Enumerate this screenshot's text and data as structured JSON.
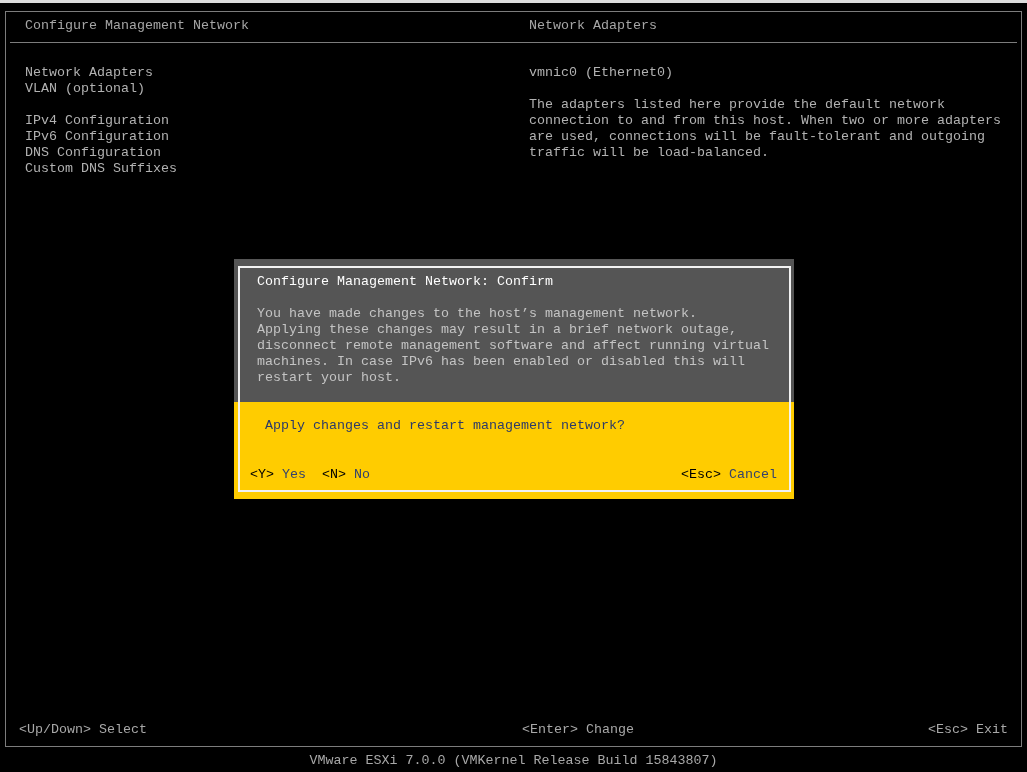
{
  "left_pane": {
    "title": "Configure Management Network",
    "menu_groups": [
      {
        "items": [
          "Network Adapters",
          "VLAN (optional)"
        ]
      },
      {
        "items": [
          "IPv4 Configuration",
          "IPv6 Configuration",
          "DNS Configuration",
          "Custom DNS Suffixes"
        ]
      }
    ]
  },
  "right_pane": {
    "title": "Network Adapters",
    "adapters": [
      "vmnic0 (Ethernet0)"
    ],
    "description": "The adapters listed here provide the default network connection to and from this host. When two or more adapters are used, connections will be fault-tolerant and outgoing traffic will be load-balanced."
  },
  "dialog": {
    "title": "Configure Management Network: Confirm",
    "message": "You have made changes to the host’s management network.\nApplying these changes may result in a brief network outage, disconnect remote management software and affect running virtual machines. In case IPv6 has been enabled or disabled this will restart your host.",
    "question": "Apply changes and restart management network?",
    "left_actions": [
      {
        "key": "<Y>",
        "label": "Yes"
      },
      {
        "key": "<N>",
        "label": "No"
      }
    ],
    "right_actions": [
      {
        "key": "<Esc>",
        "label": "Cancel"
      }
    ]
  },
  "footer": {
    "hints": [
      "<Up/Down> Select",
      "<Enter> Change",
      "<Esc> Exit"
    ]
  },
  "status_bar": {
    "text": "VMware ESXi 7.0.0 (VMKernel Release Build 15843807)"
  }
}
